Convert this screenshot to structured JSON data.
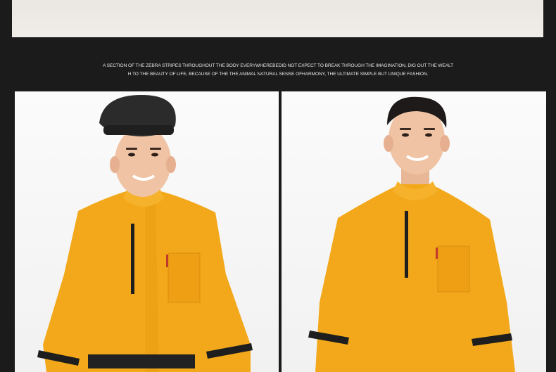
{
  "banner": {
    "kind": "product-photo-strip"
  },
  "caption": {
    "line1": "A SECTION OF THE ZEBRA STRIPES THROUGHOUT THE BODY EVERYWHEREBEDID NOT EXPECT TO BREAK THROUGH THE IMAGINATION, DIG OUT THE WEALT",
    "line2": "H TO THE BEAUTY OF LIFE, BECAUSE OF THE THE ANIMAL NATURAL SENSE OFHARMONY, THE ULTIMATE SIMPLE BUT UNIQUE FASHION."
  },
  "photos": [
    {
      "name": "model-with-hat",
      "uniform_color": "#f2a81a",
      "trim_color": "#1e1e1e"
    },
    {
      "name": "model-without-hat",
      "uniform_color": "#f2a81a",
      "trim_color": "#1e1e1e"
    }
  ]
}
